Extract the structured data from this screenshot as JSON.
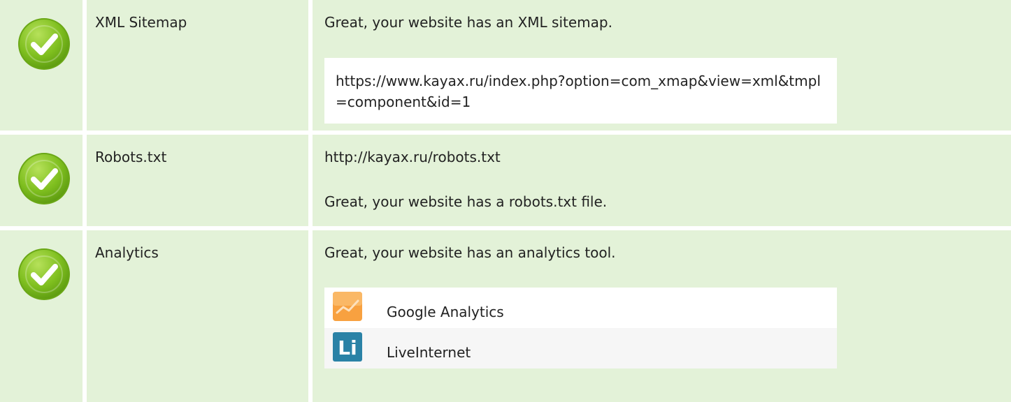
{
  "rows": [
    {
      "label": "XML Sitemap",
      "status_icon": "check-icon",
      "message": "Great, your website has an XML sitemap.",
      "url": "https://www.kayax.ru/index.php?option=com_xmap&view=xml&tmpl=component&id=1"
    },
    {
      "label": "Robots.txt",
      "status_icon": "check-icon",
      "url": "http://kayax.ru/robots.txt",
      "message": "Great, your website has a robots.txt file."
    },
    {
      "label": "Analytics",
      "status_icon": "check-icon",
      "message": "Great, your website has an analytics tool.",
      "tools": [
        {
          "name": "Google Analytics",
          "icon": "google-analytics-icon"
        },
        {
          "name": "LiveInternet",
          "icon": "liveinternet-icon",
          "icon_text": "Li"
        }
      ]
    }
  ],
  "colors": {
    "row_bg": "#e3f2d8",
    "check_green": "#7bbf1e",
    "ga_orange": "#f8a140",
    "li_teal": "#2a82a6"
  }
}
